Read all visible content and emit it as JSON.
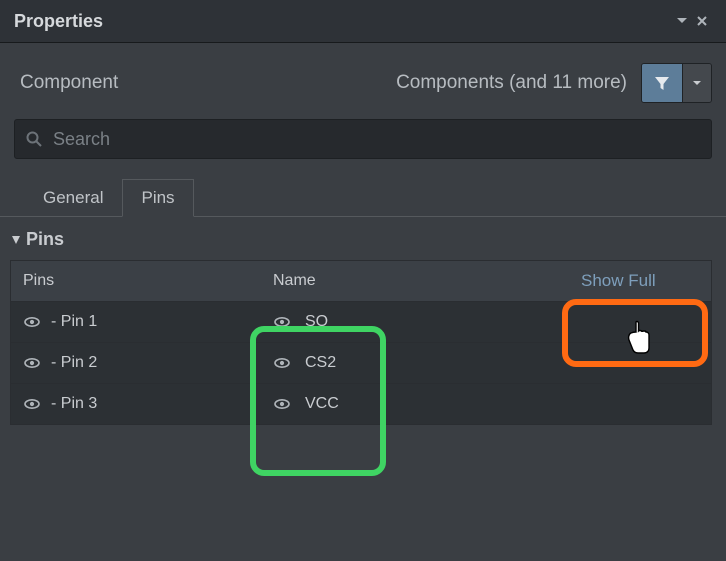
{
  "panel": {
    "title": "Properties"
  },
  "component": {
    "label": "Component",
    "count_text": "Components (and 11 more)"
  },
  "search": {
    "placeholder": "Search",
    "value": ""
  },
  "tabs": [
    {
      "label": "General",
      "active": false
    },
    {
      "label": "Pins",
      "active": true
    }
  ],
  "section": {
    "title": "Pins"
  },
  "table": {
    "headers": {
      "pins": "Pins",
      "name": "Name",
      "link": "Show Full"
    },
    "rows": [
      {
        "pin": "- Pin 1",
        "name": "SO"
      },
      {
        "pin": "- Pin 2",
        "name": "CS2"
      },
      {
        "pin": "- Pin 3",
        "name": "VCC"
      }
    ]
  }
}
